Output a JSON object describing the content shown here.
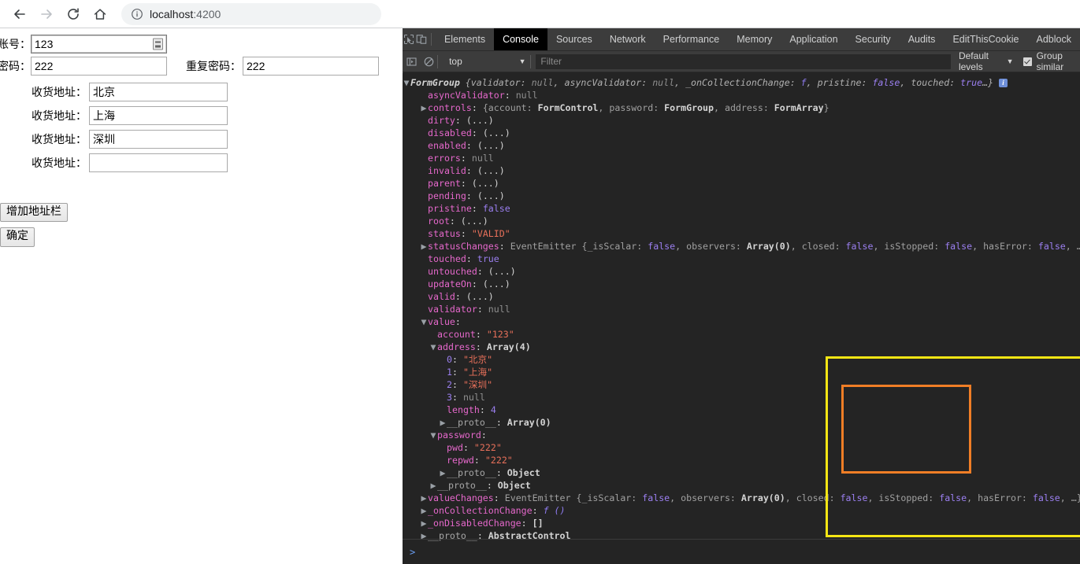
{
  "browser": {
    "back_icon": "arrow-left-icon",
    "forward_icon": "arrow-right-icon",
    "reload_icon": "reload-icon",
    "home_icon": "home-icon",
    "info_icon": "info-circle-icon",
    "url_host": "localhost",
    "url_port": ":4200"
  },
  "page": {
    "account_label": "账号：",
    "account_value": "123",
    "account_autofill_icon": "autofill-credentials-icon",
    "password_label": "密码：",
    "password_value": "222",
    "repassword_label": "重复密码：",
    "repassword_value": "222",
    "address_label": "收货地址：",
    "addresses": [
      "北京",
      "上海",
      "深圳",
      ""
    ],
    "add_address_button": "增加地址栏",
    "submit_button": "确定"
  },
  "devtools": {
    "inspect_icon": "inspect-element-icon",
    "device_icon": "device-toolbar-icon",
    "tabs": [
      {
        "label": "Elements",
        "active": false
      },
      {
        "label": "Console",
        "active": true
      },
      {
        "label": "Sources",
        "active": false
      },
      {
        "label": "Network",
        "active": false
      },
      {
        "label": "Performance",
        "active": false
      },
      {
        "label": "Memory",
        "active": false
      },
      {
        "label": "Application",
        "active": false
      },
      {
        "label": "Security",
        "active": false
      },
      {
        "label": "Audits",
        "active": false
      },
      {
        "label": "EditThisCookie",
        "active": false
      },
      {
        "label": "Adblock",
        "active": false
      }
    ],
    "filterbar": {
      "sidebar_icon": "console-sidebar-icon",
      "clear_icon": "clear-console-icon",
      "context": "top",
      "context_chevron": "chevron-down-icon",
      "filter_placeholder": "Filter",
      "filter_value": "",
      "levels_label": "Default levels",
      "levels_chevron": "chevron-down-icon",
      "group_similar_label": "Group similar",
      "group_similar_checked": true
    },
    "prompt_icon": "console-prompt-chevron-icon"
  },
  "console_log": {
    "header": {
      "name": "FormGroup",
      "preview_open": "{",
      "parts": [
        {
          "k": "validator",
          "v": "null",
          "t": "null"
        },
        {
          "k": "asyncValidator",
          "v": "null",
          "t": "null"
        },
        {
          "k": "_onCollectionChange",
          "v": "f",
          "t": "fn"
        },
        {
          "k": "pristine",
          "v": "false",
          "t": "bool"
        },
        {
          "k": "touched",
          "v": "true",
          "t": "bool"
        }
      ],
      "ellipsis": "…}",
      "badge": "i"
    },
    "rows": [
      {
        "indent": 1,
        "arrow": "",
        "key": "asyncValidator",
        "sep": ": ",
        "val": "null",
        "vt": "null"
      },
      {
        "indent": 1,
        "arrow": "▶",
        "key": "controls",
        "sep": ": ",
        "val": "{account: FormControl, password: FormGroup, address: FormArray}",
        "vt": "objpreview"
      },
      {
        "indent": 1,
        "arrow": "",
        "key": "dirty",
        "sep": ": ",
        "val": "(...)",
        "vt": "plain"
      },
      {
        "indent": 1,
        "arrow": "",
        "key": "disabled",
        "sep": ": ",
        "val": "(...)",
        "vt": "plain"
      },
      {
        "indent": 1,
        "arrow": "",
        "key": "enabled",
        "sep": ": ",
        "val": "(...)",
        "vt": "plain"
      },
      {
        "indent": 1,
        "arrow": "",
        "key": "errors",
        "sep": ": ",
        "val": "null",
        "vt": "null"
      },
      {
        "indent": 1,
        "arrow": "",
        "key": "invalid",
        "sep": ": ",
        "val": "(...)",
        "vt": "plain"
      },
      {
        "indent": 1,
        "arrow": "",
        "key": "parent",
        "sep": ": ",
        "val": "(...)",
        "vt": "plain"
      },
      {
        "indent": 1,
        "arrow": "",
        "key": "pending",
        "sep": ": ",
        "val": "(...)",
        "vt": "plain"
      },
      {
        "indent": 1,
        "arrow": "",
        "key": "pristine",
        "sep": ": ",
        "val": "false",
        "vt": "bool"
      },
      {
        "indent": 1,
        "arrow": "",
        "key": "root",
        "sep": ": ",
        "val": "(...)",
        "vt": "plain"
      },
      {
        "indent": 1,
        "arrow": "",
        "key": "status",
        "sep": ": ",
        "val": "\"VALID\"",
        "vt": "str"
      },
      {
        "indent": 1,
        "arrow": "▶",
        "key": "statusChanges",
        "sep": ": ",
        "val": "EventEmitter {_isScalar: false, observers: Array(0), closed: false, isStopped: false, hasError: false, …}",
        "vt": "emitter"
      },
      {
        "indent": 1,
        "arrow": "",
        "key": "touched",
        "sep": ": ",
        "val": "true",
        "vt": "bool"
      },
      {
        "indent": 1,
        "arrow": "",
        "key": "untouched",
        "sep": ": ",
        "val": "(...)",
        "vt": "plain"
      },
      {
        "indent": 1,
        "arrow": "",
        "key": "updateOn",
        "sep": ": ",
        "val": "(...)",
        "vt": "plain"
      },
      {
        "indent": 1,
        "arrow": "",
        "key": "valid",
        "sep": ": ",
        "val": "(...)",
        "vt": "plain"
      },
      {
        "indent": 1,
        "arrow": "",
        "key": "validator",
        "sep": ": ",
        "val": "null",
        "vt": "null"
      },
      {
        "indent": 1,
        "arrow": "▼",
        "key": "value",
        "sep": ":",
        "val": "",
        "vt": "plain"
      },
      {
        "indent": 2,
        "arrow": "",
        "key": "account",
        "sep": ": ",
        "val": "\"123\"",
        "vt": "str"
      },
      {
        "indent": 2,
        "arrow": "▼",
        "key": "address",
        "sep": ": ",
        "val": "Array(4)",
        "vt": "class"
      },
      {
        "indent": 3,
        "arrow": "",
        "key": "0",
        "sep": ": ",
        "val": "\"北京\"",
        "vt": "str",
        "idx": true
      },
      {
        "indent": 3,
        "arrow": "",
        "key": "1",
        "sep": ": ",
        "val": "\"上海\"",
        "vt": "str",
        "idx": true
      },
      {
        "indent": 3,
        "arrow": "",
        "key": "2",
        "sep": ": ",
        "val": "\"深圳\"",
        "vt": "str",
        "idx": true
      },
      {
        "indent": 3,
        "arrow": "",
        "key": "3",
        "sep": ": ",
        "val": "null",
        "vt": "null",
        "idx": true
      },
      {
        "indent": 3,
        "arrow": "",
        "key": "length",
        "sep": ": ",
        "val": "4",
        "vt": "num"
      },
      {
        "indent": 3,
        "arrow": "▶",
        "key": "__proto__",
        "sep": ": ",
        "val": "Array(0)",
        "vt": "class",
        "proto": true
      },
      {
        "indent": 2,
        "arrow": "▼",
        "key": "password",
        "sep": ":",
        "val": "",
        "vt": "plain"
      },
      {
        "indent": 3,
        "arrow": "",
        "key": "pwd",
        "sep": ": ",
        "val": "\"222\"",
        "vt": "str"
      },
      {
        "indent": 3,
        "arrow": "",
        "key": "repwd",
        "sep": ": ",
        "val": "\"222\"",
        "vt": "str"
      },
      {
        "indent": 3,
        "arrow": "▶",
        "key": "__proto__",
        "sep": ": ",
        "val": "Object",
        "vt": "class",
        "proto": true
      },
      {
        "indent": 2,
        "arrow": "▶",
        "key": "__proto__",
        "sep": ": ",
        "val": "Object",
        "vt": "class",
        "proto": true
      },
      {
        "indent": 1,
        "arrow": "▶",
        "key": "valueChanges",
        "sep": ": ",
        "val": "EventEmitter {_isScalar: false, observers: Array(0), closed: false, isStopped: false, hasError: false, …}",
        "vt": "emitter"
      },
      {
        "indent": 1,
        "arrow": "▶",
        "key": "_onCollectionChange",
        "sep": ": ",
        "val": "f ()",
        "vt": "fn"
      },
      {
        "indent": 1,
        "arrow": "▶",
        "key": "_onDisabledChange",
        "sep": ": ",
        "val": "[]",
        "vt": "class"
      },
      {
        "indent": 1,
        "arrow": "▶",
        "key": "__proto__",
        "sep": ": ",
        "val": "AbstractControl",
        "vt": "class",
        "proto": true
      }
    ]
  },
  "annotations": {
    "yellow_box": "value-object-highlight",
    "orange_box": "address-array-highlight",
    "yellow_color": "#f5e614",
    "orange_color": "#f07e26"
  }
}
